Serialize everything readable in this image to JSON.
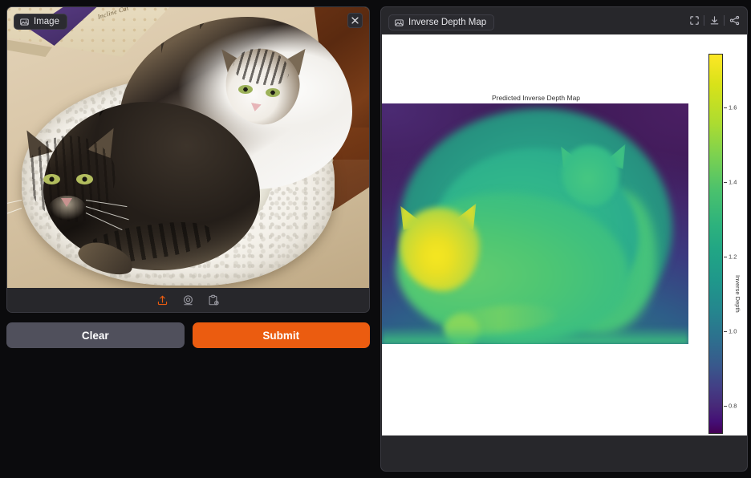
{
  "app": {
    "background_color": "#0b0b0d",
    "panel_color": "#27272b"
  },
  "left_panel": {
    "tab_label": "Image",
    "tab_icon": "image-icon",
    "close_icon": "close-icon",
    "photo": {
      "description": "Two tabby cats curled up together in a white fleece pet bed on beige carpet, with a cardboard box in the upper-left corner and dark wooden floor at the upper right.",
      "box_text": "Incline Cat"
    },
    "toolbar": [
      {
        "name": "upload-icon",
        "label": "Upload",
        "color": "#eb5c10"
      },
      {
        "name": "webcam-icon",
        "label": "Webcam",
        "color": "#9b9ba3"
      },
      {
        "name": "paste-clipboard-icon",
        "label": "Paste from clipboard",
        "color": "#9b9ba3"
      }
    ],
    "buttons": {
      "clear_label": "Clear",
      "clear_color": "#50505c",
      "submit_label": "Submit",
      "submit_color": "#eb5c10"
    }
  },
  "right_panel": {
    "tab_label": "Inverse Depth Map",
    "tab_icon": "image-icon",
    "tools": [
      {
        "name": "fullscreen-icon",
        "label": "Fullscreen"
      },
      {
        "name": "download-icon",
        "label": "Download"
      },
      {
        "name": "share-icon",
        "label": "Share"
      }
    ]
  },
  "chart_data": {
    "type": "heatmap",
    "title": "Predicted Inverse Depth Map",
    "xlabel": "",
    "ylabel": "",
    "colorbar": {
      "label": "Inverse Depth",
      "colormap": "viridis",
      "ticks": [
        0.8,
        1.0,
        1.2,
        1.4,
        1.6
      ],
      "tick_labels": [
        "0.8",
        "1.0",
        "1.2",
        "1.4",
        "1.6"
      ],
      "vmin": 0.7,
      "vmax": 1.72,
      "position": "right",
      "low_color": "#440154",
      "high_color": "#fde725"
    },
    "grid": false,
    "axes_visible": false,
    "regions": [
      {
        "name": "front-cat-face",
        "approx_value": 1.7,
        "color": "#fde725"
      },
      {
        "name": "front-cat-body",
        "approx_value": 1.45,
        "color": "#6ece58"
      },
      {
        "name": "back-cat-body",
        "approx_value": 1.28,
        "color": "#2fb47c"
      },
      {
        "name": "pet-bed-rim",
        "approx_value": 1.22,
        "color": "#29af7f"
      },
      {
        "name": "carpet-foreground",
        "approx_value": 1.35,
        "color": "#4ac16d"
      },
      {
        "name": "background-floor-corners",
        "approx_value": 0.78,
        "color": "#46307e"
      }
    ]
  }
}
